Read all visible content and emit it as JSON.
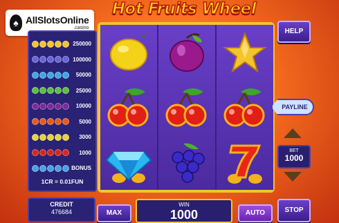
{
  "logo": {
    "text": "AllSlotsOnline",
    "sub": ".casino"
  },
  "game_title": "Hot Fruits Wheel",
  "paytable": {
    "rows": [
      {
        "value": "250000",
        "colors": [
          "#f3c52c",
          "#f3c52c",
          "#f3c52c",
          "#f3c52c",
          "#f3c52c"
        ]
      },
      {
        "value": "100000",
        "colors": [
          "#6a63d8",
          "#6a63d8",
          "#6a63d8",
          "#6a63d8",
          "#6a63d8"
        ]
      },
      {
        "value": "50000",
        "colors": [
          "#3fa6e6",
          "#3fa6e6",
          "#3fa6e6",
          "#3fa6e6",
          "#3fa6e6"
        ]
      },
      {
        "value": "25000",
        "colors": [
          "#5dbf3c",
          "#5dbf3c",
          "#5dbf3c",
          "#5dbf3c",
          "#5dbf3c"
        ]
      },
      {
        "value": "10000",
        "colors": [
          "#7a2a9a",
          "#7a2a9a",
          "#7a2a9a",
          "#7a2a9a",
          "#7a2a9a"
        ]
      },
      {
        "value": "5000",
        "colors": [
          "#e85a1a",
          "#e85a1a",
          "#e85a1a",
          "#e85a1a",
          "#e85a1a"
        ]
      },
      {
        "value": "3000",
        "colors": [
          "#e6d23a",
          "#e6d23a",
          "#e6d23a",
          "#e6d23a",
          "#e6d23a"
        ]
      },
      {
        "value": "1000",
        "colors": [
          "#d9261c",
          "#d9261c",
          "#d9261c",
          "#d9261c",
          "#d9261c"
        ]
      },
      {
        "value": "BONUS",
        "colors": [
          "#4aa0e6",
          "#4aa0e6",
          "#4aa0e6",
          "#4aa0e6",
          "#4aa0e6"
        ]
      }
    ],
    "credit_ratio": "1CR = 0.01FUN"
  },
  "reels": [
    [
      "lemon",
      "cherries",
      "diamond"
    ],
    [
      "plum",
      "cherries",
      "grapes"
    ],
    [
      "star",
      "cherries",
      "seven"
    ]
  ],
  "buttons": {
    "help": "HELP",
    "payline": "PAYLINE",
    "max": "MAX",
    "auto": "AUTO",
    "stop": "STOP"
  },
  "bet": {
    "label": "BET",
    "value": "1000"
  },
  "credit": {
    "label": "CREDIT",
    "value": "476684"
  },
  "win": {
    "label": "WIN",
    "value": "1000"
  },
  "colors": {
    "accent_gold": "#f3c52c",
    "panel_purple": "#2a2274",
    "reel_purple": "#5a35b5"
  }
}
